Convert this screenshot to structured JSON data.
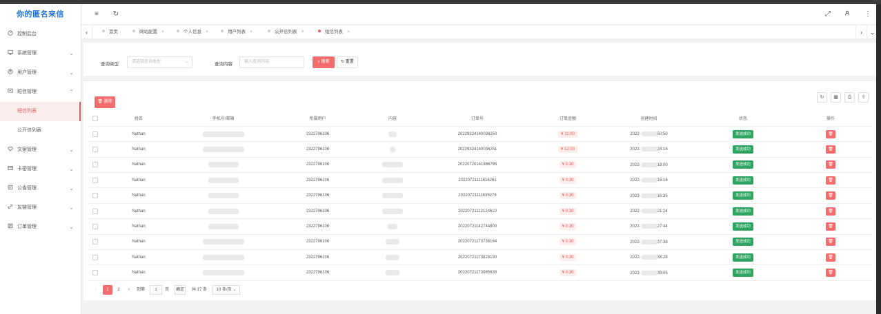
{
  "app": {
    "brand": "你的匿名来信"
  },
  "sidebar": {
    "items": [
      {
        "label": "控制后台",
        "icon": "dashboard-icon"
      },
      {
        "label": "系统管理",
        "icon": "monitor-icon"
      },
      {
        "label": "用户管理",
        "icon": "user-icon"
      },
      {
        "label": "短信管理",
        "icon": "message-icon"
      },
      {
        "label": "文案管理",
        "icon": "heart-icon"
      },
      {
        "label": "卡密管理",
        "icon": "card-icon"
      },
      {
        "label": "公告管理",
        "icon": "notice-icon"
      },
      {
        "label": "友链管理",
        "icon": "link-icon"
      },
      {
        "label": "订单管理",
        "icon": "order-icon"
      }
    ],
    "sub_items": [
      {
        "label": "短信列表"
      },
      {
        "label": "公开信列表"
      }
    ]
  },
  "tabs": [
    {
      "label": "首页"
    },
    {
      "label": "网站配置"
    },
    {
      "label": "个人信息"
    },
    {
      "label": "用户列表"
    },
    {
      "label": "公开信列表"
    },
    {
      "label": "短信列表"
    }
  ],
  "search": {
    "type_label": "查询类型",
    "type_placeholder": "请选择查询类型",
    "content_label": "查询内容",
    "content_placeholder": "输入查询内容",
    "search_button": "搜索",
    "reset_button": "重置"
  },
  "toolbar": {
    "delete_button": "删除"
  },
  "table": {
    "headers": [
      "姓名",
      "手机号/邮箱",
      "所属用户",
      "内容",
      "订单号",
      "订单金额",
      "创建时间",
      "状态",
      "操作"
    ],
    "rows": [
      {
        "name": "Nathan",
        "user": "2322796106",
        "order": "20229324140036250",
        "amount": "¥ 11.00",
        "time_prefix": "2022-",
        "time_suffix": "50:50",
        "status": "发送成功"
      },
      {
        "name": "Nathan",
        "user": "2322796106",
        "order": "20229324140036251",
        "amount": "¥ 12.00",
        "time_prefix": "2022-",
        "time_suffix": "24:16",
        "status": "发送成功"
      },
      {
        "name": "Nathan",
        "user": "2322796106",
        "order": "20220720141886795",
        "amount": "¥ 0.10",
        "time_prefix": "2022-",
        "time_suffix": "18:00",
        "status": "发送成功"
      },
      {
        "name": "Nathan",
        "user": "2322796106",
        "order": "20220721111516261",
        "amount": "¥ 0.10",
        "time_prefix": "2022-",
        "time_suffix": "15:16",
        "status": "发送成功"
      },
      {
        "name": "Nathan",
        "user": "2322796106",
        "order": "20220721111635278",
        "amount": "¥ 0.10",
        "time_prefix": "2022-",
        "time_suffix": "16:35",
        "status": "发送成功"
      },
      {
        "name": "Nathan",
        "user": "2322796106",
        "order": "20220721112124610",
        "amount": "¥ 0.10",
        "time_prefix": "2022-",
        "time_suffix": "21:24",
        "status": "发送成功"
      },
      {
        "name": "Nathan",
        "user": "2322796106",
        "order": "20220721142744800",
        "amount": "¥ 0.10",
        "time_prefix": "2022-",
        "time_suffix": "27:44",
        "status": "发送成功"
      },
      {
        "name": "Nathan",
        "user": "2322796106",
        "order": "20220721173738164",
        "amount": "¥ 0.10",
        "time_prefix": "2022-",
        "time_suffix": "37:38",
        "status": "发送成功"
      },
      {
        "name": "Nathan",
        "user": "2322796106",
        "order": "20220721173828190",
        "amount": "¥ 0.10",
        "time_prefix": "2022-",
        "time_suffix": "38:28",
        "status": "发送成功"
      },
      {
        "name": "Nathan",
        "user": "2322796106",
        "order": "20220721173985639",
        "amount": "¥ 0.10",
        "time_prefix": "2022-",
        "time_suffix": "39:05",
        "status": "发送成功"
      }
    ]
  },
  "pagination": {
    "pages": [
      "1",
      "2"
    ],
    "goto_label": "到第",
    "goto_value": "1",
    "page_unit": "页",
    "confirm": "确定",
    "total": "共 17 条",
    "page_size": "10 条/页"
  },
  "colors": {
    "accent": "#f56c6c",
    "success": "#2fa561",
    "brand": "#1e73d8"
  }
}
